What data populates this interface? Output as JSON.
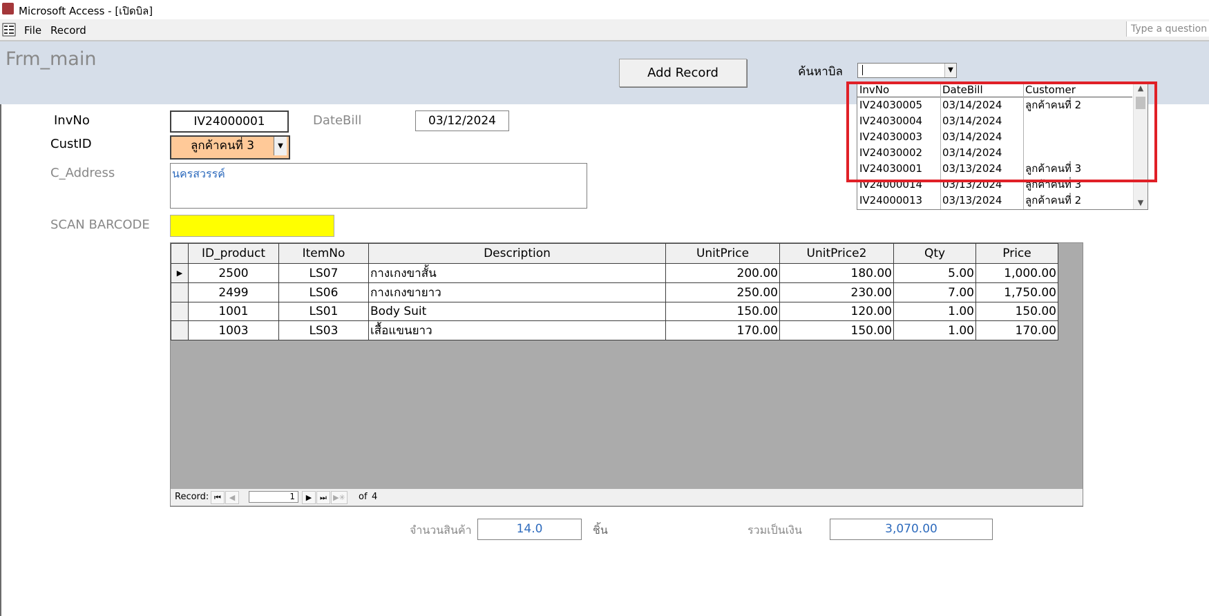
{
  "window": {
    "title": "Microsoft Access - [เปิดบิล]"
  },
  "menu": {
    "file": "File",
    "record": "Record",
    "ask_placeholder": "Type a question f"
  },
  "form": {
    "caption": "Frm_main",
    "add_record": "Add Record",
    "search_label": "ค้นหาบิล",
    "search_value": ""
  },
  "dropdown": {
    "headers": [
      "InvNo",
      "DateBill",
      "Customer"
    ],
    "rows": [
      [
        "IV24030005",
        "03/14/2024",
        "ลูกค้าคนที่ 2"
      ],
      [
        "IV24030004",
        "03/14/2024",
        ""
      ],
      [
        "IV24030003",
        "03/14/2024",
        ""
      ],
      [
        "IV24030002",
        "03/14/2024",
        ""
      ],
      [
        "IV24030001",
        "03/13/2024",
        "ลูกค้าคนที่ 3"
      ],
      [
        "IV24000014",
        "03/13/2024",
        "ลูกค้าคนที่ 3"
      ],
      [
        "IV24000013",
        "03/13/2024",
        "ลูกค้าคนที่ 2"
      ]
    ],
    "highlight_color": "#e02027"
  },
  "fields": {
    "invno_label": "InvNo",
    "invno": "IV24000001",
    "datebill_label": "DateBill",
    "datebill": "03/12/2024",
    "custid_label": "CustID",
    "custid": "ลูกค้าคนที่ 3",
    "address_label": "C_Address",
    "address": "นครสวรรค์",
    "barcode_label": "SCAN BARCODE",
    "barcode": ""
  },
  "grid": {
    "columns": [
      "ID_product",
      "ItemNo",
      "Description",
      "UnitPrice",
      "UnitPrice2",
      "Qty",
      "Price"
    ],
    "rows": [
      [
        "2500",
        "LS07",
        "กางเกงขาสั้น",
        "200.00",
        "180.00",
        "5.00",
        "1,000.00"
      ],
      [
        "2499",
        "LS06",
        "กางเกงขายาว",
        "250.00",
        "230.00",
        "7.00",
        "1,750.00"
      ],
      [
        "1001",
        "LS01",
        "Body Suit",
        "150.00",
        "120.00",
        "1.00",
        "150.00"
      ],
      [
        "1003",
        "LS03",
        "เสื้อแขนยาว",
        "170.00",
        "150.00",
        "1.00",
        "170.00"
      ]
    ]
  },
  "navigation": {
    "label": "Record:",
    "current": "1",
    "of_label": "of",
    "total": "4"
  },
  "summary": {
    "qty_label": "จำนวนสินค้า",
    "qty_value": "14.0",
    "qty_unit": "ชิ้น",
    "total_label": "รวมเป็นเงิน",
    "total_value": "3,070.00"
  },
  "colors": {
    "header_bg": "#d6dee9",
    "barcode_bg": "#ffff00",
    "cust_bg": "#ffc998",
    "link_blue": "#2e6bbd"
  }
}
